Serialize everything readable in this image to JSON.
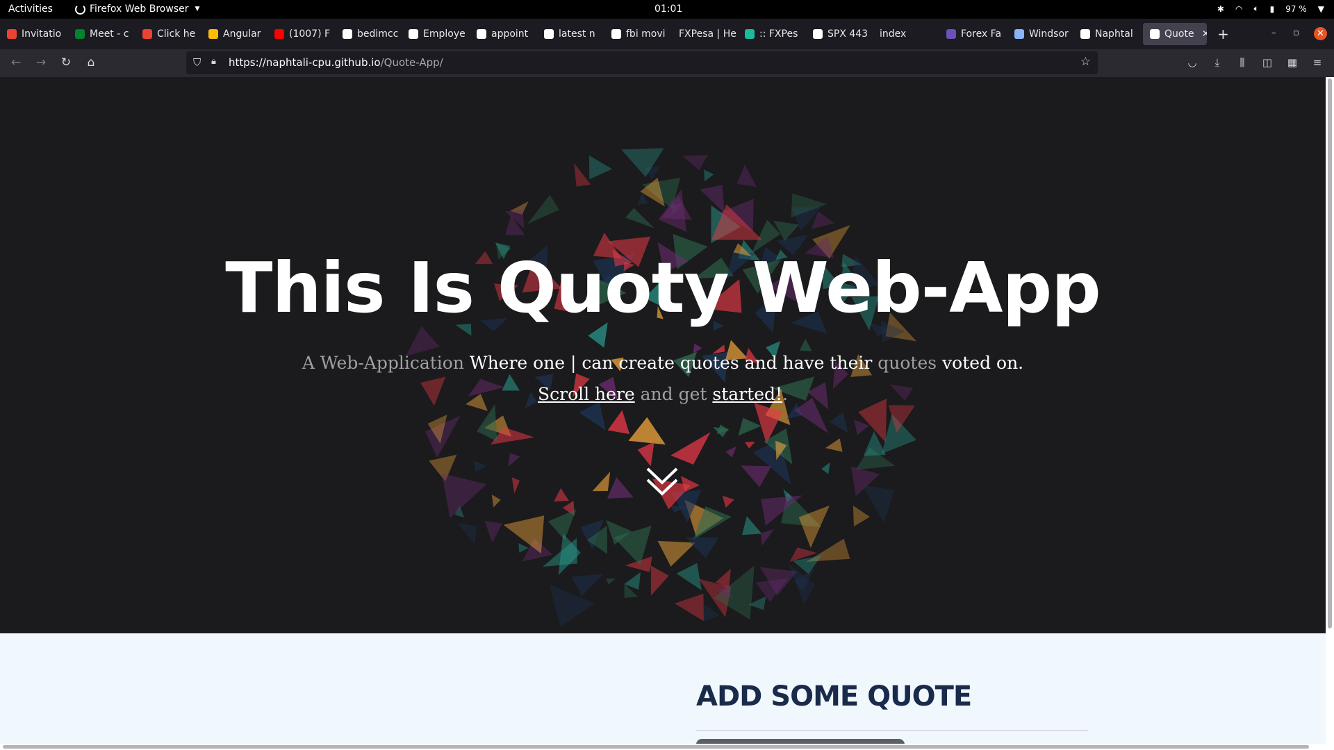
{
  "os_bar": {
    "activities": "Activities",
    "app_name": "Firefox Web Browser",
    "clock": "01:01",
    "battery": "97 %"
  },
  "tabs": [
    {
      "label": "Invitatio",
      "favicon_color": "#ea4335"
    },
    {
      "label": "Meet - c",
      "favicon_color": "#00832d"
    },
    {
      "label": "Click he",
      "favicon_color": "#ea4335"
    },
    {
      "label": "Angular",
      "favicon_color": "#fbbc04"
    },
    {
      "label": "(1007) F",
      "favicon_color": "#ff0000"
    },
    {
      "label": "bedimcc",
      "favicon_color": "#ffffff"
    },
    {
      "label": "Employe",
      "favicon_color": "#ffffff"
    },
    {
      "label": "appoint",
      "favicon_color": "#ffffff"
    },
    {
      "label": "latest n",
      "favicon_color": "#ffffff"
    },
    {
      "label": "fbi movi",
      "favicon_color": "#ffffff"
    },
    {
      "label": "FXPesa | He",
      "favicon_color": ""
    },
    {
      "label": ":: FXPes",
      "favicon_color": "#1abc9c"
    },
    {
      "label": "SPX 443",
      "favicon_color": "#ffffff"
    },
    {
      "label": "index",
      "favicon_color": ""
    },
    {
      "label": "Forex Fa",
      "favicon_color": "#6b4fbb"
    },
    {
      "label": "Windsor",
      "favicon_color": "#8ab4f8"
    },
    {
      "label": "Naphtal",
      "favicon_color": "#ffffff"
    },
    {
      "label": "Quote",
      "favicon_color": "#ffffff",
      "active": true
    }
  ],
  "nav": {
    "url_host": "https://naphtali-cpu.github.io",
    "url_path": "/Quote-App/"
  },
  "hero": {
    "title": "This Is Quoty Web-App",
    "sub_muted_1": "A Web-Application",
    "sub_main": "Where one | can create quotes and have their",
    "sub_muted_2": "quotes",
    "sub_end": "voted on.",
    "scroll_link": "Scroll here",
    "middle": "and get",
    "started_link": "started!",
    "period": "."
  },
  "section": {
    "title": "ADD SOME QUOTE"
  },
  "colors": {
    "hero_bg": "#1b1a1c",
    "section_bg": "#f0f8fd",
    "section_title": "#1a2a4a",
    "shard_palette": [
      "#e63946",
      "#e9a23b",
      "#2a9d8f",
      "#1d3557",
      "#6a2c70",
      "#2d6a4f"
    ]
  }
}
